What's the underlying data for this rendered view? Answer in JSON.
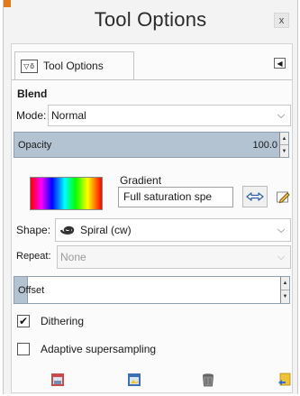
{
  "window": {
    "title": "Tool Options",
    "close_label": "x"
  },
  "tab": {
    "label": "Tool Options",
    "icon": "tool-options-icon"
  },
  "section": {
    "title": "Blend"
  },
  "mode": {
    "label": "Mode:",
    "value": "Normal"
  },
  "opacity": {
    "label": "Opacity",
    "value": "100.0"
  },
  "gradient": {
    "label": "Gradient",
    "value": "Full saturation spe"
  },
  "shape": {
    "label": "Shape:",
    "value": "Spiral (cw)"
  },
  "repeat": {
    "label": "Repeat:",
    "value": "None"
  },
  "offset": {
    "label": "Offset"
  },
  "dithering": {
    "label": "Dithering",
    "checked": true
  },
  "adaptive": {
    "label": "Adaptive supersampling",
    "checked": false
  },
  "colors": {
    "accent": "#e07a1a",
    "slider": "#b3c3d2"
  }
}
